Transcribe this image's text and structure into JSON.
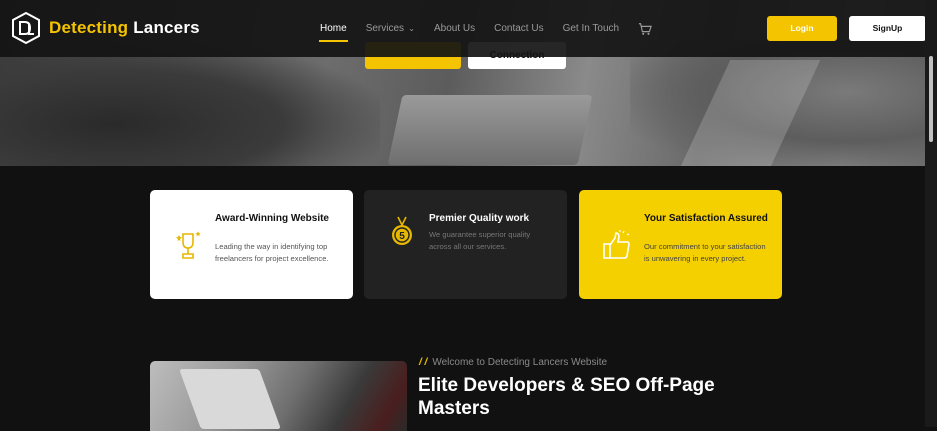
{
  "brand": {
    "name_part1": "Detecting",
    "name_part2": "Lancers",
    "accent": "#f5c400"
  },
  "nav": {
    "items": [
      {
        "label": "Home",
        "active": true
      },
      {
        "label": "Services",
        "active": false,
        "dropdown": true
      },
      {
        "label": "About Us",
        "active": false
      },
      {
        "label": "Contact Us",
        "active": false
      },
      {
        "label": "Get In Touch",
        "active": false
      }
    ],
    "cart_icon": "cart-icon"
  },
  "auth": {
    "login_label": "Login",
    "signup_label": "SignUp"
  },
  "hero": {
    "secondary_button_label": "Connection"
  },
  "features": [
    {
      "icon": "trophy-icon",
      "title": "Award-Winning Website",
      "description": "Leading the way in identifying top freelancers for project excellence."
    },
    {
      "icon": "medal-icon",
      "title": "Premier Quality work",
      "description": "We guarantee superior quality across all our services."
    },
    {
      "icon": "thumbs-up-icon",
      "title": "Your Satisfaction Assured",
      "description": "Our commitment to your satisfaction is unwavering in every project."
    }
  ],
  "about": {
    "slashes": "/ /",
    "welcome": "Welcome to Detecting Lancers Website",
    "headline": "Elite Developers & SEO Off-Page Masters"
  }
}
